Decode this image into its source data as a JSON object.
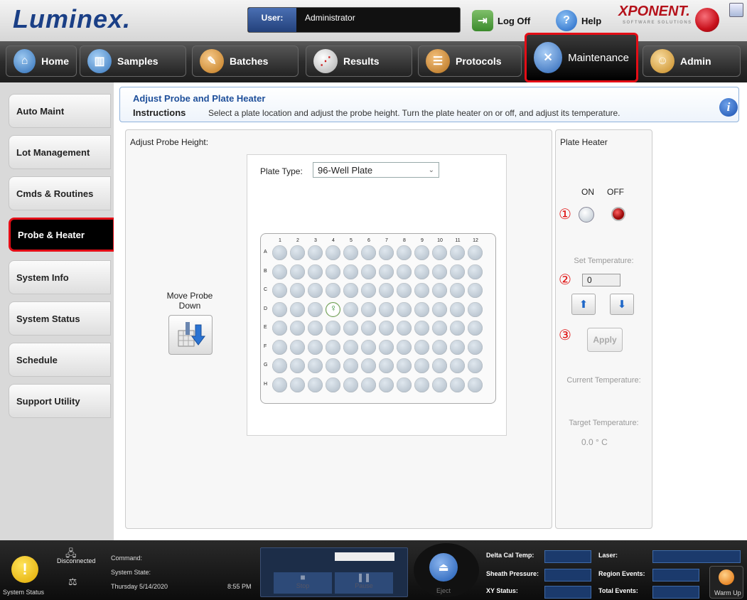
{
  "header": {
    "logo": "Luminex.",
    "user_label": "User:",
    "user_value": "Administrator",
    "logoff_label": "Log Off",
    "help_label": "Help",
    "brand_logo": "XPONENT.",
    "brand_sub": "SOFTWARE SOLUTIONS"
  },
  "tabs": [
    {
      "label": "Home",
      "icon": "home-icon",
      "color": "#3f84c8"
    },
    {
      "label": "Samples",
      "icon": "samples-icon",
      "color": "#4a8bd0"
    },
    {
      "label": "Batches",
      "icon": "batches-icon",
      "color": "#d88a2a"
    },
    {
      "label": "Results",
      "icon": "results-icon",
      "color": "#c8c8c8"
    },
    {
      "label": "Protocols",
      "icon": "protocols-icon",
      "color": "#d28a2c"
    },
    {
      "label": "Maintenance",
      "icon": "maintenance-icon",
      "color": "#3d76c8",
      "active": true
    },
    {
      "label": "Admin",
      "icon": "admin-icon",
      "color": "#e0a030"
    }
  ],
  "sidebar": {
    "items": [
      {
        "label": "Auto Maint"
      },
      {
        "label": "Lot Management"
      },
      {
        "label": "Cmds & Routines"
      },
      {
        "label": "Probe & Heater",
        "active": true
      },
      {
        "label": "System Info"
      },
      {
        "label": "System Status"
      },
      {
        "label": "Schedule"
      },
      {
        "label": "Support Utility"
      }
    ]
  },
  "instructions": {
    "title": "Adjust Probe and Plate Heater",
    "label": "Instructions",
    "text": "Select a plate location and adjust the probe height. Turn the plate heater on or off, and adjust its temperature."
  },
  "probe": {
    "title": "Adjust Probe Height:",
    "move_label": "Move Probe Down",
    "plate_type_label": "Plate Type:",
    "plate_type_value": "96-Well Plate",
    "columns": [
      "1",
      "2",
      "3",
      "4",
      "5",
      "6",
      "7",
      "8",
      "9",
      "10",
      "11",
      "12"
    ],
    "rows": [
      "A",
      "B",
      "C",
      "D",
      "E",
      "F",
      "G",
      "H"
    ],
    "selected_well": "D4"
  },
  "heater": {
    "title": "Plate Heater",
    "on_label": "ON",
    "off_label": "OFF",
    "step1": "①",
    "step2": "②",
    "step3": "③",
    "state": "OFF",
    "set_temp_label": "Set Temperature:",
    "set_temp_value": "0",
    "apply_label": "Apply",
    "current_temp_label": "Current Temperature:",
    "target_temp_label": "Target Temperature:",
    "target_temp_value": "0.0 ° C"
  },
  "status": {
    "system_status_label": "System Status",
    "connection_label": "Disconnected",
    "command_label": "Command:",
    "system_state_label": "System State:",
    "date": "Thursday 5/14/2020",
    "time": "8:55 PM",
    "stop_label": "Stop",
    "pause_label": "Pause",
    "eject_label": "Eject",
    "readouts_left": [
      "Delta Cal Temp:",
      "Sheath Pressure:",
      "XY Status:"
    ],
    "readouts_right": [
      "Laser:",
      "Region Events:",
      "Total Events:"
    ],
    "warmup_label": "Warm Up"
  }
}
